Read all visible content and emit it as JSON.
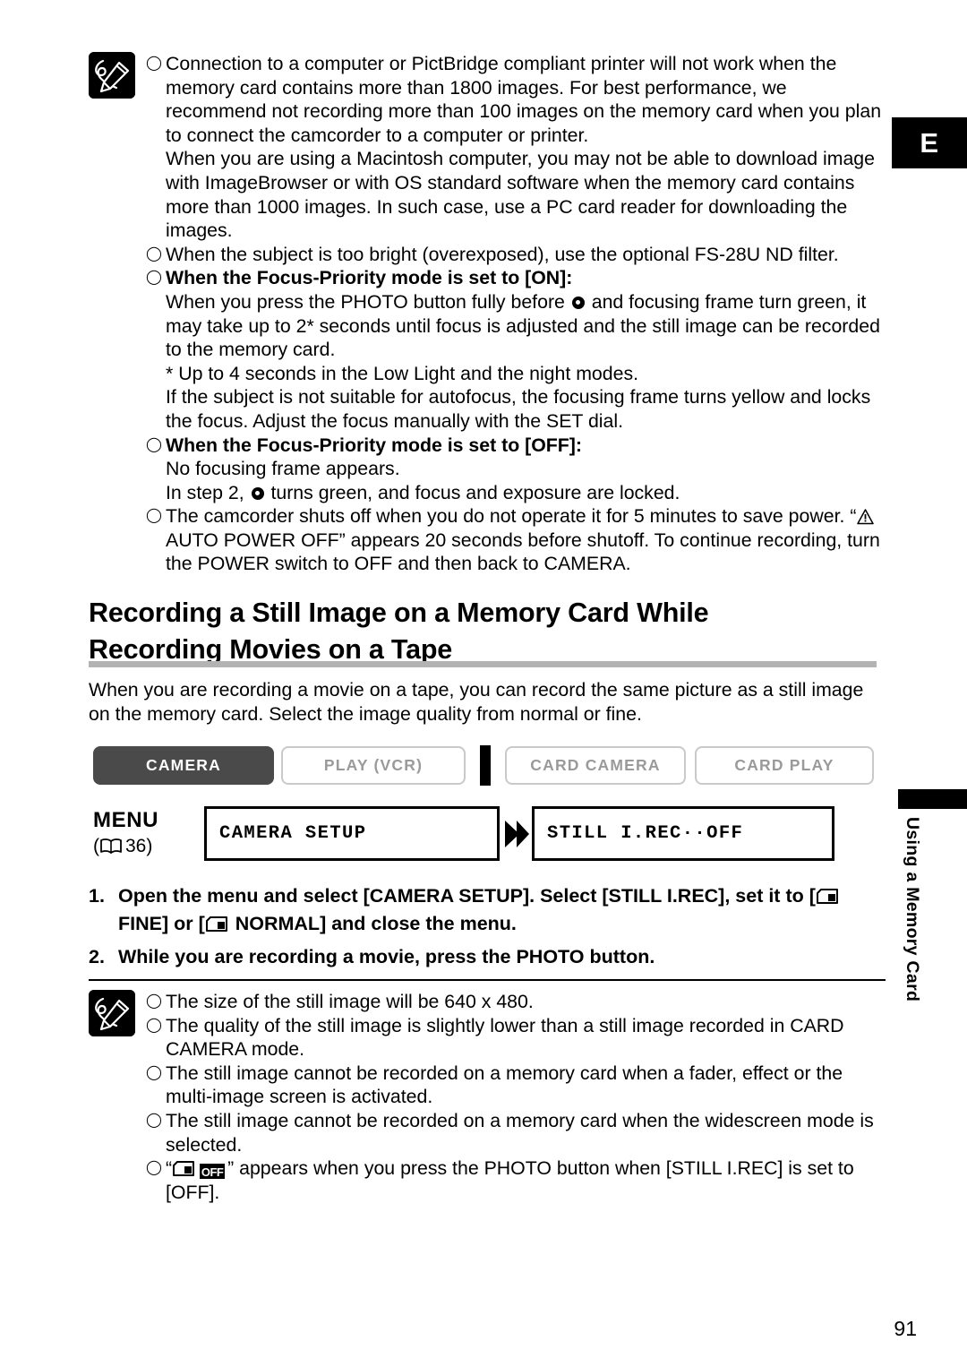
{
  "page": {
    "number": "91",
    "chapter_tab": "E",
    "side_label": "Using a Memory Card"
  },
  "top_note": {
    "icon": "memo-pencil-icon",
    "items": [
      {
        "bullet": "open-circle",
        "bold": false,
        "text": "Connection to a computer or PictBridge compliant printer will not work when the memory card contains more than 1800 images. For best performance, we recommend not recording more than 100 images on the memory card when you plan to connect the camcorder to a computer or printer."
      },
      {
        "bullet": "none",
        "bold": false,
        "text": "When you are using a Macintosh computer, you may not be able to download image with ImageBrowser or with OS standard software when the memory card contains more than 1000 images. In such case, use a PC card reader for downloading the images."
      },
      {
        "bullet": "open-circle",
        "bold": false,
        "text": "When the subject is too bright (overexposed), use the optional FS-28U ND filter."
      },
      {
        "bullet": "open-circle",
        "bold": true,
        "text": "When the Focus-Priority mode is set to [ON]:"
      },
      {
        "bullet": "none",
        "bold": false,
        "text_before_icon": "When you press the PHOTO button fully before ",
        "inline_icon": "focus-dot-icon",
        "text_after_icon": " and focusing frame turn green, it may take up to 2* seconds until focus is adjusted and the still image can be recorded to the memory card."
      },
      {
        "bullet": "none",
        "bold": false,
        "text": "* Up to 4 seconds in the Low Light and the night modes."
      },
      {
        "bullet": "none",
        "bold": false,
        "text": "If the subject is not suitable for autofocus, the focusing frame turns yellow and locks the focus. Adjust the focus manually with the SET dial."
      },
      {
        "bullet": "open-circle",
        "bold": true,
        "text": "When the Focus-Priority mode is set to [OFF]:"
      },
      {
        "bullet": "none",
        "bold": false,
        "text": "No focusing frame appears."
      },
      {
        "bullet": "none",
        "bold": false,
        "text_before_icon": "In step 2, ",
        "inline_icon": "focus-dot-icon",
        "text_after_icon": " turns green, and focus and exposure are locked."
      },
      {
        "bullet": "open-circle",
        "bold": false,
        "text_before_icon": "The camcorder shuts off when you do not operate it for 5 minutes to save power. “",
        "inline_icon": "warning-triangle-icon",
        "text_after_icon": " AUTO POWER OFF” appears 20 seconds before shutoff. To continue recording, turn the POWER switch to OFF and then back to CAMERA."
      }
    ]
  },
  "section": {
    "heading_line1": "Recording a Still Image on a Memory Card While",
    "heading_line2": "Recording Movies on a Tape",
    "intro": "When you are recording a movie on a tape, you can record the same picture as a still image on the memory card. Select the image quality from normal or fine."
  },
  "modes": {
    "camera": "CAMERA",
    "play_vcr": "PLAY (VCR)",
    "card_camera": "CARD CAMERA",
    "card_play": "CARD PLAY",
    "active": "CAMERA"
  },
  "menu": {
    "label": "MENU",
    "ref_page": "36",
    "box1": "CAMERA SETUP",
    "box2": "STILL I.REC··OFF",
    "arrow": "play-arrow-icon",
    "book_icon": "open-book-icon"
  },
  "steps": [
    {
      "number": "1.",
      "text_a": "Open the menu and select [CAMERA SETUP]. Select [STILL I.REC], set it to [",
      "icon1": "memory-card-icon",
      "text_b": " FINE] or [",
      "icon2": "memory-card-icon",
      "text_c": " NORMAL] and close the menu."
    },
    {
      "number": "2.",
      "text_a": "While you are recording a movie, press the PHOTO button.",
      "icon1": "",
      "text_b": "",
      "icon2": "",
      "text_c": ""
    }
  ],
  "bottom_note": {
    "icon": "memo-pencil-icon",
    "items": [
      {
        "bullet": "open-circle",
        "text": "The size of the still image will be 640 x 480."
      },
      {
        "bullet": "open-circle",
        "text": "The quality of the still image is slightly lower than a still image recorded in CARD CAMERA mode."
      },
      {
        "bullet": "open-circle",
        "text": "The still image cannot be recorded on a memory card when a fader, effect or the multi-image screen is activated."
      },
      {
        "bullet": "open-circle",
        "text": "The still image cannot be recorded on a memory card when the widescreen mode is selected."
      },
      {
        "bullet": "open-circle",
        "quote_open": "“",
        "icon_card": "memory-card-icon",
        "icon_off": "OFF",
        "quote_close": "”",
        "text": " appears when you press the PHOTO button when [STILL I.REC] is set to [OFF]."
      }
    ]
  }
}
